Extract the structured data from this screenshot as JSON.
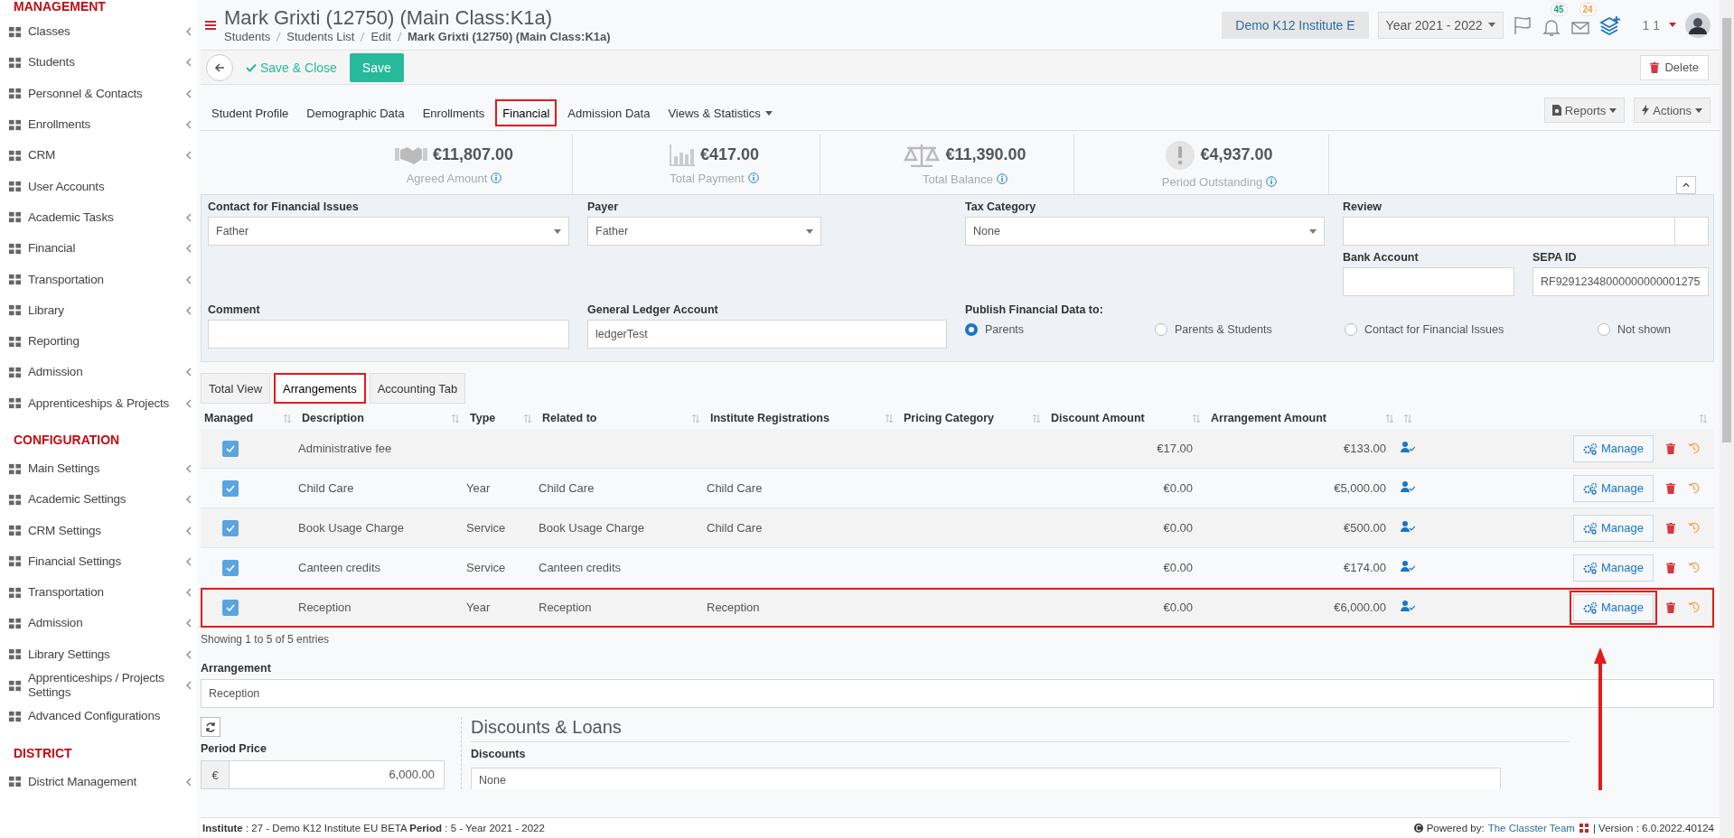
{
  "sidebar": {
    "sections": [
      {
        "title": "MANAGEMENT",
        "items": [
          {
            "label": "Classes",
            "expandable": true
          },
          {
            "label": "Students",
            "expandable": true
          },
          {
            "label": "Personnel & Contacts",
            "expandable": true
          },
          {
            "label": "Enrollments",
            "expandable": true
          },
          {
            "label": "CRM",
            "expandable": true
          },
          {
            "label": "User Accounts",
            "expandable": false
          },
          {
            "label": "Academic Tasks",
            "expandable": true
          },
          {
            "label": "Financial",
            "expandable": true
          },
          {
            "label": "Transportation",
            "expandable": true
          },
          {
            "label": "Library",
            "expandable": true
          },
          {
            "label": "Reporting",
            "expandable": false
          },
          {
            "label": "Admission",
            "expandable": true
          },
          {
            "label": "Apprenticeships & Projects",
            "expandable": true
          }
        ]
      },
      {
        "title": "CONFIGURATION",
        "items": [
          {
            "label": "Main Settings",
            "expandable": true
          },
          {
            "label": "Academic Settings",
            "expandable": true
          },
          {
            "label": "CRM Settings",
            "expandable": true
          },
          {
            "label": "Financial Settings",
            "expandable": true
          },
          {
            "label": "Transportation",
            "expandable": true
          },
          {
            "label": "Admission",
            "expandable": true
          },
          {
            "label": "Library Settings",
            "expandable": true
          },
          {
            "label": "Apprenticeships / Projects Settings",
            "expandable": true
          },
          {
            "label": "Advanced Configurations",
            "expandable": false
          }
        ]
      },
      {
        "title": "DISTRICT",
        "items": [
          {
            "label": "District Management",
            "expandable": true
          }
        ]
      }
    ]
  },
  "header": {
    "title": "Mark Grixti (12750) (Main Class:K1a)",
    "breadcrumbs": [
      "Students",
      "Students List",
      "Edit",
      "Mark Grixti (12750) (Main Class:K1a)"
    ],
    "institute": "Demo K12 Institute E",
    "year": "Year 2021 - 2022",
    "notifications": "45",
    "messages": "24",
    "user": "1 1"
  },
  "toolbar": {
    "save_close": "Save & Close",
    "save": "Save",
    "delete": "Delete"
  },
  "tabs": [
    {
      "label": "Student Profile",
      "selected": false
    },
    {
      "label": "Demographic Data",
      "selected": false
    },
    {
      "label": "Enrollments",
      "selected": false
    },
    {
      "label": "Financial",
      "selected": true
    },
    {
      "label": "Admission Data",
      "selected": false
    },
    {
      "label": "Views & Statistics",
      "selected": false
    }
  ],
  "tab_actions": [
    "Reports",
    "Actions"
  ],
  "kpis": [
    {
      "value": "€11,807.00",
      "label": "Agreed Amount",
      "kind": "handshake"
    },
    {
      "value": "€417.00",
      "label": "Total Payment",
      "kind": "chart"
    },
    {
      "value": "€11,390.00",
      "label": "Total Balance",
      "kind": "scale"
    },
    {
      "value": "€4,937.00",
      "label": "Period Outstanding",
      "kind": "alert"
    }
  ],
  "form": {
    "contact": {
      "label": "Contact for Financial Issues",
      "value": "Father"
    },
    "payer": {
      "label": "Payer",
      "value": "Father"
    },
    "tax_category": {
      "label": "Tax Category",
      "value": "None"
    },
    "review": {
      "label": "Review"
    },
    "bank_account": {
      "label": "Bank Account"
    },
    "sepa_id": {
      "label": "SEPA ID",
      "value": "RF92912348000000000001275"
    },
    "comment": {
      "label": "Comment"
    },
    "ledger": {
      "label": "General Ledger Account",
      "value": "ledgerTest"
    },
    "publish": {
      "label": "Publish Financial Data to:",
      "options": [
        {
          "label": "Parents",
          "selected": true
        },
        {
          "label": "Parents & Students",
          "selected": false
        },
        {
          "label": "Contact for Financial Issues",
          "selected": false
        },
        {
          "label": "Not shown",
          "selected": false
        }
      ]
    }
  },
  "subtabs": [
    {
      "label": "Total View",
      "selected": false
    },
    {
      "label": "Arrangements",
      "selected": true
    },
    {
      "label": "Accounting Tab",
      "selected": false
    }
  ],
  "table": {
    "columns": [
      "Managed",
      "Description",
      "Type",
      "Related to",
      "Institute Registrations",
      "Pricing Category",
      "Discount Amount",
      "Arrangement Amount"
    ],
    "rows": [
      {
        "checked": true,
        "highlighted": false,
        "description": "Administrative fee",
        "discount": "€17.00",
        "amount": "€133.00",
        "manage": "Manage"
      },
      {
        "checked": true,
        "highlighted": false,
        "description": "Child Care",
        "type": "Year",
        "related_to": "Child Care",
        "registrations": "Child Care",
        "discount": "€0.00",
        "amount": "€5,000.00",
        "manage": "Manage"
      },
      {
        "checked": true,
        "highlighted": false,
        "description": "Book Usage Charge",
        "type": "Service",
        "related_to": "Book Usage Charge",
        "registrations": "Child Care",
        "discount": "€0.00",
        "amount": "€500.00",
        "manage": "Manage"
      },
      {
        "checked": true,
        "highlighted": false,
        "description": "Canteen credits",
        "type": "Service",
        "related_to": "Canteen credits",
        "discount": "€0.00",
        "amount": "€174.00",
        "manage": "Manage"
      },
      {
        "checked": true,
        "highlighted": true,
        "description": "Reception",
        "type": "Year",
        "related_to": "Reception",
        "registrations": "Reception",
        "discount": "€0.00",
        "amount": "€6,000.00",
        "manage": "Manage"
      }
    ],
    "info": "Showing 1 to 5 of 5 entries"
  },
  "arrangement": {
    "label": "Arrangement",
    "value": "Reception"
  },
  "period_price": {
    "label": "Period Price",
    "currency": "€",
    "value": "6,000.00"
  },
  "discounts": {
    "title": "Discounts & Loans",
    "label": "Discounts",
    "value": "None"
  },
  "footer": {
    "info": "**Institute** : 27 - Demo K12 Institute EU BETA **Period** : 5 - Year 2021 - 2022",
    "powered": "Powered by:",
    "team": "The Classter Team",
    "version": "| Version : 6.0.2022.40124"
  }
}
